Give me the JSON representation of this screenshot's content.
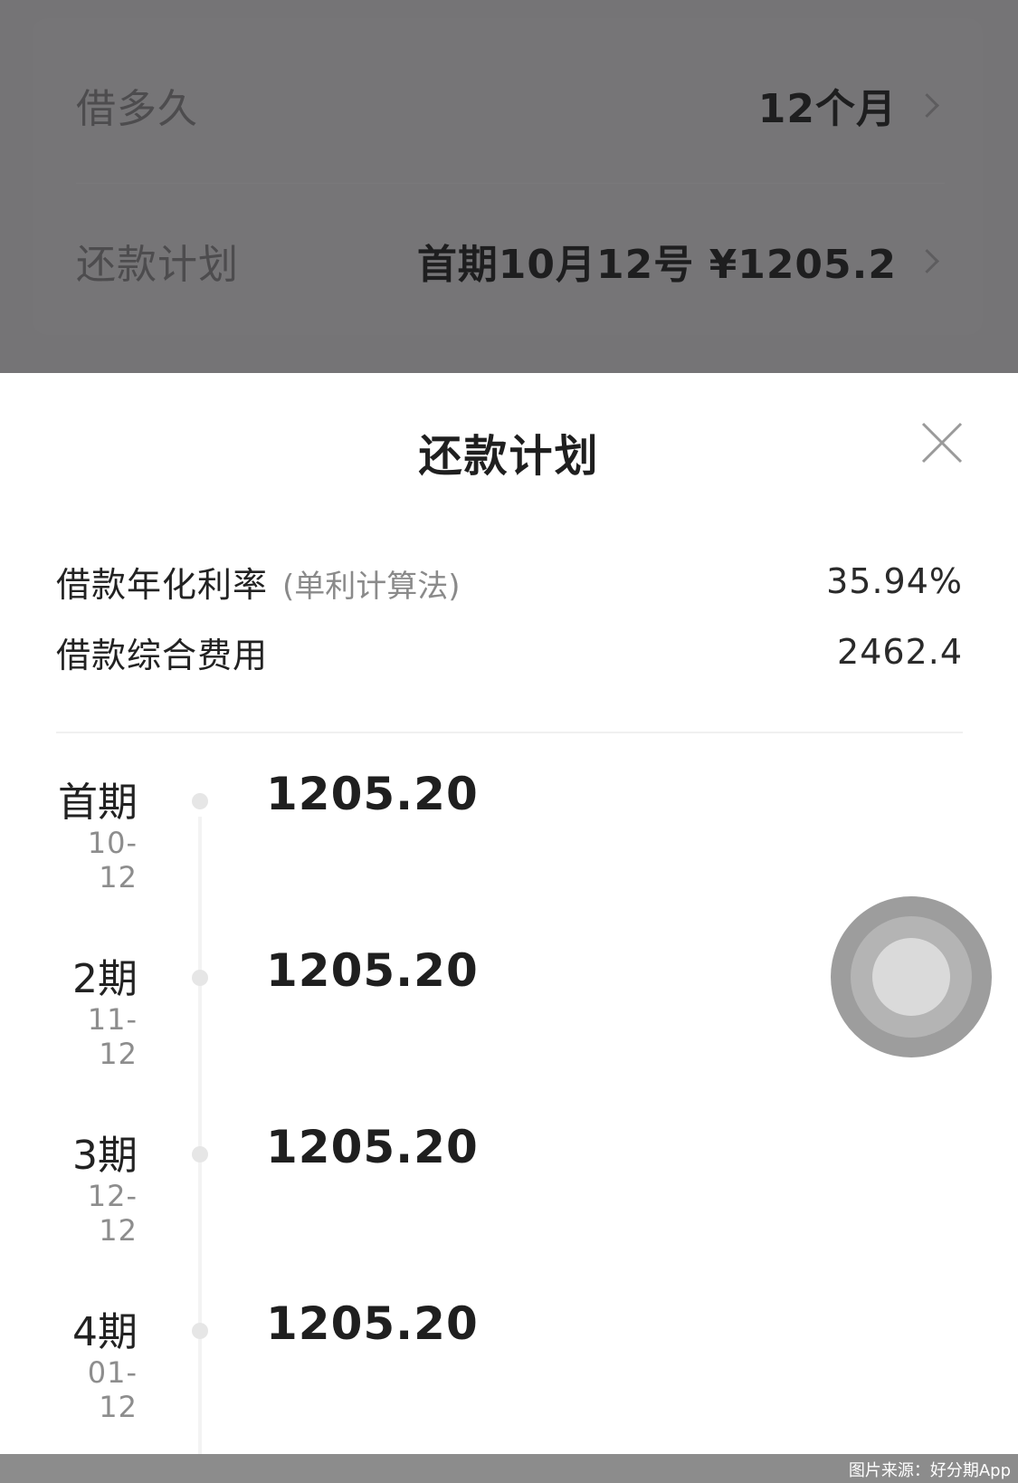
{
  "background": {
    "rows": [
      {
        "label": "借多久",
        "value": "12个月"
      },
      {
        "label": "还款计划",
        "value": "首期10月12号 ¥1205.2"
      }
    ]
  },
  "sheet": {
    "title": "还款计划",
    "close_icon": "close-icon",
    "rate": {
      "label": "借款年化利率",
      "note": "(单利计算法)",
      "value": "35.94%"
    },
    "fee": {
      "label": "借款综合费用",
      "value": "2462.4"
    },
    "periods": [
      {
        "name": "首期",
        "date": "10-12",
        "amount": "1205.20"
      },
      {
        "name": "2期",
        "date": "11-12",
        "amount": "1205.20"
      },
      {
        "name": "3期",
        "date": "12-12",
        "amount": "1205.20"
      },
      {
        "name": "4期",
        "date": "01-12",
        "amount": "1205.20"
      }
    ]
  },
  "caption": "图片来源：好分期App",
  "colors": {
    "overlay": "#757476",
    "sheet": "#ffffff",
    "text_primary": "#1f1f1f",
    "text_secondary": "#8d8d8d",
    "timeline": "#f3f3f3"
  }
}
